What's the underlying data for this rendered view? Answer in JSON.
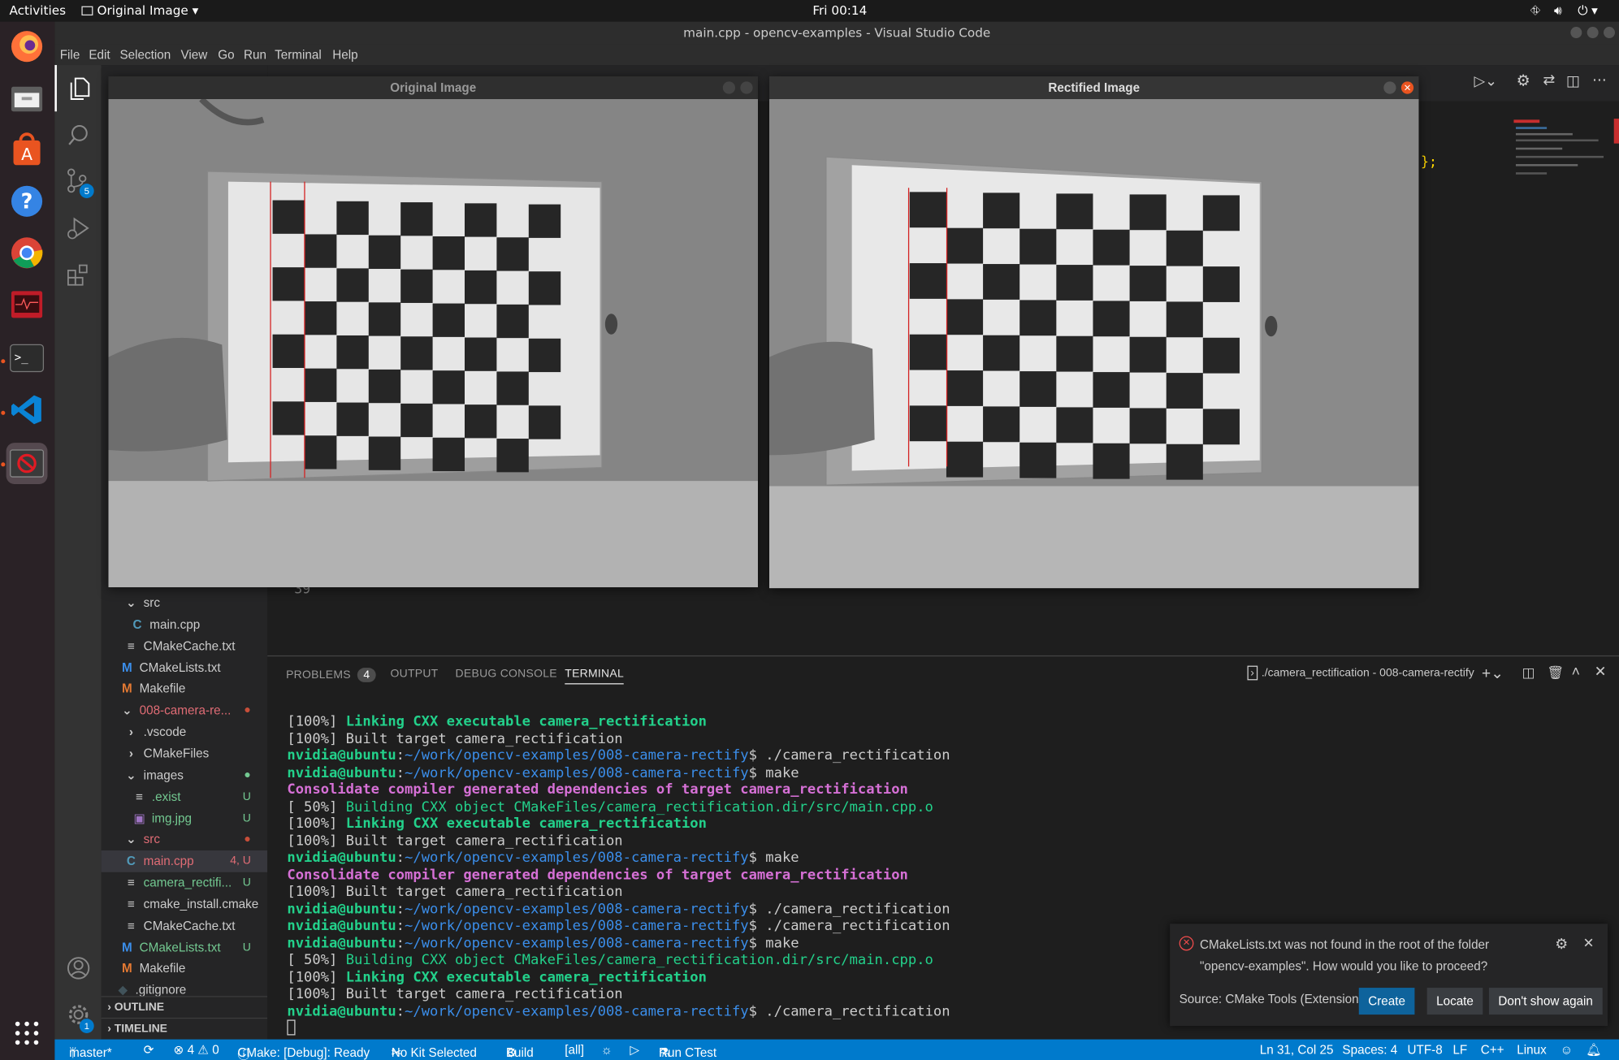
{
  "topbar": {
    "activities": "Activities",
    "app_menu": "Original Image",
    "clock": "Fri 00:14"
  },
  "window": {
    "title": "main.cpp - opencv-examples - Visual Studio Code"
  },
  "menu": [
    "File",
    "Edit",
    "Selection",
    "View",
    "Go",
    "Run",
    "Terminal",
    "Help"
  ],
  "activity": {
    "scm_badge": "5",
    "settings_badge": "1"
  },
  "explorer": {
    "items": [
      {
        "label": "src",
        "badge": "",
        "type": "folder-open"
      },
      {
        "label": "main.cpp",
        "badge": "",
        "type": "cpp"
      },
      {
        "label": "CMakeCache.txt",
        "badge": "",
        "type": "txt"
      },
      {
        "label": "CMakeLists.txt",
        "badge": "",
        "type": "cmake"
      },
      {
        "label": "Makefile",
        "badge": "",
        "type": "make"
      },
      {
        "label": "008-camera-re...",
        "badge": "●",
        "type": "folder-open"
      },
      {
        "label": ".vscode",
        "badge": "",
        "type": "folder"
      },
      {
        "label": "CMakeFiles",
        "badge": "",
        "type": "folder"
      },
      {
        "label": "images",
        "badge": "●",
        "type": "folder-open"
      },
      {
        "label": ".exist",
        "badge": "U",
        "type": "txt"
      },
      {
        "label": "img.jpg",
        "badge": "U",
        "type": "img"
      },
      {
        "label": "src",
        "badge": "●",
        "type": "folder-open"
      },
      {
        "label": "main.cpp",
        "badge": "4, U",
        "type": "cpp"
      },
      {
        "label": "camera_rectifi...",
        "badge": "U",
        "type": "txt"
      },
      {
        "label": "cmake_install.cmake",
        "badge": "",
        "type": "txt"
      },
      {
        "label": "CMakeCache.txt",
        "badge": "",
        "type": "txt"
      },
      {
        "label": "CMakeLists.txt",
        "badge": "U",
        "type": "cmake"
      },
      {
        "label": "Makefile",
        "badge": "",
        "type": "make"
      },
      {
        "label": ".gitignore",
        "badge": "",
        "type": "git"
      }
    ],
    "outline": "OUTLINE",
    "timeline": "TIMELINE"
  },
  "editor": {
    "line_number": "39",
    "frag_semicolon": "};"
  },
  "panel": {
    "tabs": {
      "problems": "PROBLEMS",
      "problems_count": "4",
      "output": "OUTPUT",
      "debug": "DEBUG CONSOLE",
      "terminal": "TERMINAL"
    },
    "terminal_name": "./camera_rectification - 008-camera-rectify",
    "terminal_lines": [
      [
        {
          "c": "",
          "t": "[100%] "
        },
        {
          "c": "g",
          "t": "Linking CXX executable camera_rectification"
        }
      ],
      [
        {
          "c": "",
          "t": "[100%] Built target camera_rectification"
        }
      ],
      [
        {
          "c": "g",
          "t": "nvidia@ubuntu"
        },
        {
          "c": "",
          "t": ":"
        },
        {
          "c": "b",
          "t": "~/work/opencv-examples/008-camera-rectify"
        },
        {
          "c": "",
          "t": "$ ./camera_rectification"
        }
      ],
      [
        {
          "c": "g",
          "t": "nvidia@ubuntu"
        },
        {
          "c": "",
          "t": ":"
        },
        {
          "c": "b",
          "t": "~/work/opencv-examples/008-camera-rectify"
        },
        {
          "c": "",
          "t": "$ make"
        }
      ],
      [
        {
          "c": "m",
          "t": "Consolidate compiler generated dependencies of target camera_rectification"
        }
      ],
      [
        {
          "c": "",
          "t": "[ 50%] "
        },
        {
          "c": "gp",
          "t": "Building CXX object CMakeFiles/camera_rectification.dir/src/main.cpp.o"
        }
      ],
      [
        {
          "c": "",
          "t": "[100%] "
        },
        {
          "c": "g",
          "t": "Linking CXX executable camera_rectification"
        }
      ],
      [
        {
          "c": "",
          "t": "[100%] Built target camera_rectification"
        }
      ],
      [
        {
          "c": "g",
          "t": "nvidia@ubuntu"
        },
        {
          "c": "",
          "t": ":"
        },
        {
          "c": "b",
          "t": "~/work/opencv-examples/008-camera-rectify"
        },
        {
          "c": "",
          "t": "$ make"
        }
      ],
      [
        {
          "c": "m",
          "t": "Consolidate compiler generated dependencies of target camera_rectification"
        }
      ],
      [
        {
          "c": "",
          "t": "[100%] Built target camera_rectification"
        }
      ],
      [
        {
          "c": "g",
          "t": "nvidia@ubuntu"
        },
        {
          "c": "",
          "t": ":"
        },
        {
          "c": "b",
          "t": "~/work/opencv-examples/008-camera-rectify"
        },
        {
          "c": "",
          "t": "$ ./camera_rectification"
        }
      ],
      [
        {
          "c": "g",
          "t": "nvidia@ubuntu"
        },
        {
          "c": "",
          "t": ":"
        },
        {
          "c": "b",
          "t": "~/work/opencv-examples/008-camera-rectify"
        },
        {
          "c": "",
          "t": "$ ./camera_rectification"
        }
      ],
      [
        {
          "c": "g",
          "t": "nvidia@ubuntu"
        },
        {
          "c": "",
          "t": ":"
        },
        {
          "c": "b",
          "t": "~/work/opencv-examples/008-camera-rectify"
        },
        {
          "c": "",
          "t": "$ make"
        }
      ],
      [
        {
          "c": "",
          "t": "[ 50%] "
        },
        {
          "c": "gp",
          "t": "Building CXX object CMakeFiles/camera_rectification.dir/src/main.cpp.o"
        }
      ],
      [
        {
          "c": "",
          "t": "[100%] "
        },
        {
          "c": "g",
          "t": "Linking CXX executable camera_rectification"
        }
      ],
      [
        {
          "c": "",
          "t": "[100%] Built target camera_rectification"
        }
      ],
      [
        {
          "c": "g",
          "t": "nvidia@ubuntu"
        },
        {
          "c": "",
          "t": ":"
        },
        {
          "c": "b",
          "t": "~/work/opencv-examples/008-camera-rectify"
        },
        {
          "c": "",
          "t": "$ ./camera_rectification"
        }
      ]
    ]
  },
  "windows": {
    "original": "Original Image",
    "rectified": "Rectified Image"
  },
  "notification": {
    "line1": "CMakeLists.txt was not found in the root of the folder",
    "line2": "\"opencv-examples\". How would you like to proceed?",
    "source": "Source: CMake Tools (Extension)",
    "create": "Create",
    "locate": "Locate",
    "dont_show": "Don't show again"
  },
  "status": {
    "branch": "master*",
    "problems": "⊗ 4 ⚠ 0",
    "cmake": "CMake: [Debug]: Ready",
    "kit": "No Kit Selected",
    "build": "Build",
    "target": "[all]",
    "ctest": "Run CTest",
    "position": "Ln 31, Col 25",
    "spaces": "Spaces: 4",
    "encoding": "UTF-8",
    "eol": "LF",
    "lang": "C++",
    "os": "Linux"
  },
  "colors": {
    "accent": "#007acc",
    "terminal_green": "#23d18b",
    "terminal_blue": "#3b8eea",
    "terminal_magenta": "#d670d6",
    "ubuntu_orange": "#e95420"
  }
}
